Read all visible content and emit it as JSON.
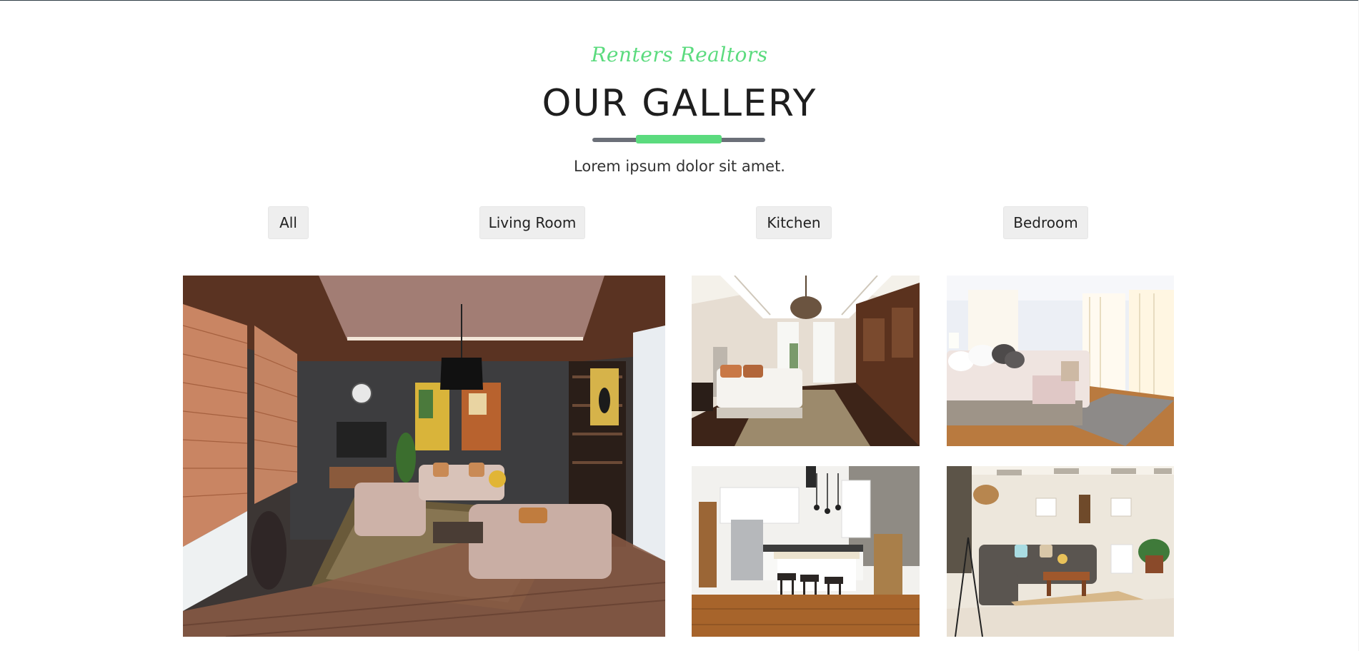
{
  "header": {
    "brand": "Renters Realtors",
    "title": "OUR GALLERY",
    "subtitle": "Lorem ipsum dolor sit amet.",
    "accent_color": "#5bdb7e"
  },
  "filters": [
    {
      "label": "All"
    },
    {
      "label": "Living Room"
    },
    {
      "label": "Kitchen"
    },
    {
      "label": "Bedroom"
    }
  ],
  "gallery": [
    {
      "subject": "living room with wooden blinds, artwork and beige sofas"
    },
    {
      "subject": "bedroom with chandelier and wood cabinetry"
    },
    {
      "subject": "bright bedroom with sheer curtains"
    },
    {
      "subject": "white kitchen with island and bar stools"
    },
    {
      "subject": "living room with grey sectional and coffee table"
    }
  ]
}
